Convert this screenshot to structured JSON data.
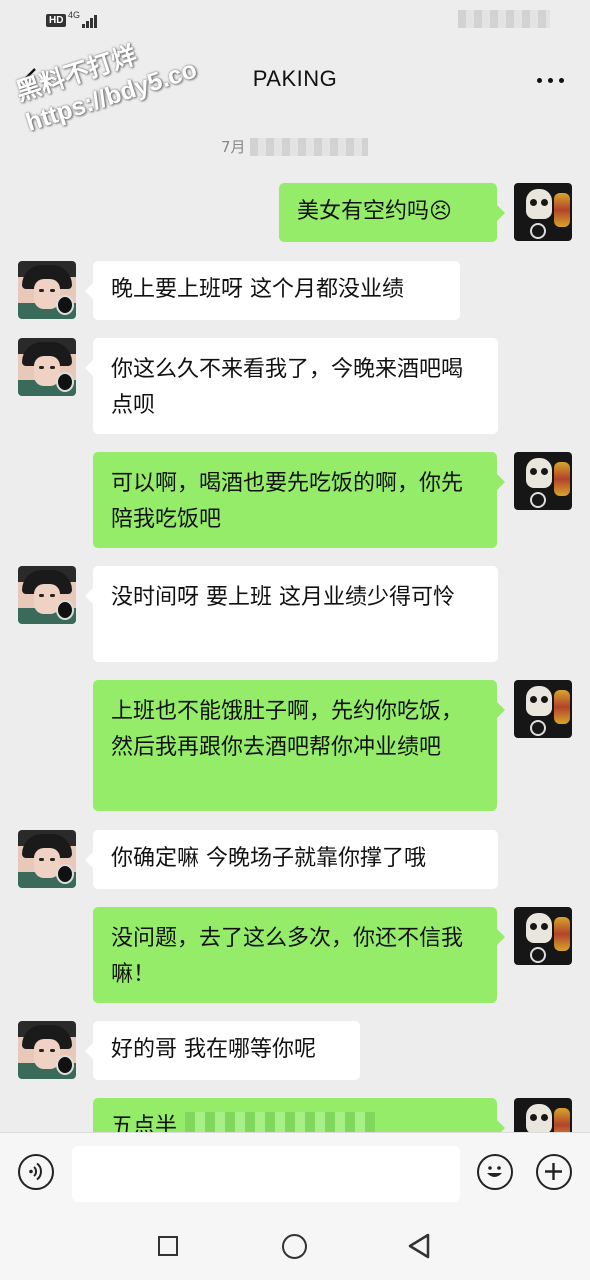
{
  "status_bar": {
    "hd_label": "HD",
    "network_label": "4G"
  },
  "header": {
    "title": "PAKING"
  },
  "watermark": {
    "line1": "黑料不打烊",
    "line2": "https://bdy5.co"
  },
  "timestamp": "7月",
  "messages": [
    {
      "side": "right",
      "text": "美女有空约吗😣"
    },
    {
      "side": "left",
      "text": "晚上要上班呀 这个月都没业绩"
    },
    {
      "side": "left",
      "text": "你这么久不来看我了，今晚来酒吧喝点呗"
    },
    {
      "side": "right",
      "text": "可以啊，喝酒也要先吃饭的啊，你先陪我吃饭吧"
    },
    {
      "side": "left",
      "text": "没时间呀 要上班 这月业绩少得可怜"
    },
    {
      "side": "right",
      "text": "上班也不能饿肚子啊，先约你吃饭，然后我再跟你去酒吧帮你冲业绩吧"
    },
    {
      "side": "left",
      "text": "你确定嘛 今晚场子就靠你撑了哦"
    },
    {
      "side": "right",
      "text": "没问题，去了这么多次，你还不信我嘛！"
    },
    {
      "side": "left",
      "text": "好的哥 我在哪等你呢"
    },
    {
      "side": "right",
      "text": "五点半"
    }
  ],
  "icons": {
    "back": "chevron-left-icon",
    "more": "more-dots-icon",
    "voice": "voice-icon",
    "emoji": "emoji-icon",
    "add": "plus-icon"
  },
  "colors": {
    "background": "#ededed",
    "self_bubble": "#95ec69",
    "other_bubble": "#ffffff"
  }
}
